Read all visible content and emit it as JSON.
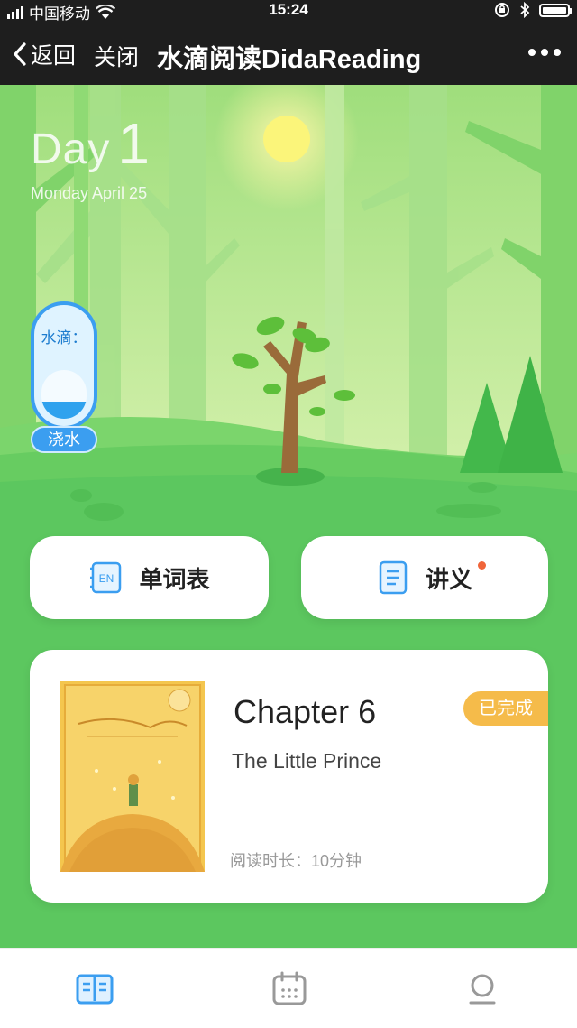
{
  "status_bar": {
    "carrier": "中国移动",
    "time": "15:24"
  },
  "nav": {
    "back_label": "返回",
    "close_label": "关闭",
    "title": "水滴阅读DidaReading"
  },
  "hero": {
    "day_word": "Day",
    "day_number": "1",
    "date": "Monday  April 25"
  },
  "water": {
    "label": "水滴：",
    "button": "浇水",
    "level": 0.35
  },
  "actions": {
    "wordlist_label": "单词表",
    "wordlist_icon_text": "EN",
    "notes_label": "讲义"
  },
  "book": {
    "chapter": "Chapter 6",
    "title": "The Little Prince",
    "read_time": "阅读时长：10分钟",
    "status": "已完成"
  },
  "colors": {
    "accent": "#3b9ef0",
    "grass": "#5cc75f",
    "badge": "#f5bb4a",
    "notify": "#f0653a"
  },
  "tabs": [
    "book-icon",
    "calendar-icon",
    "profile-icon"
  ]
}
